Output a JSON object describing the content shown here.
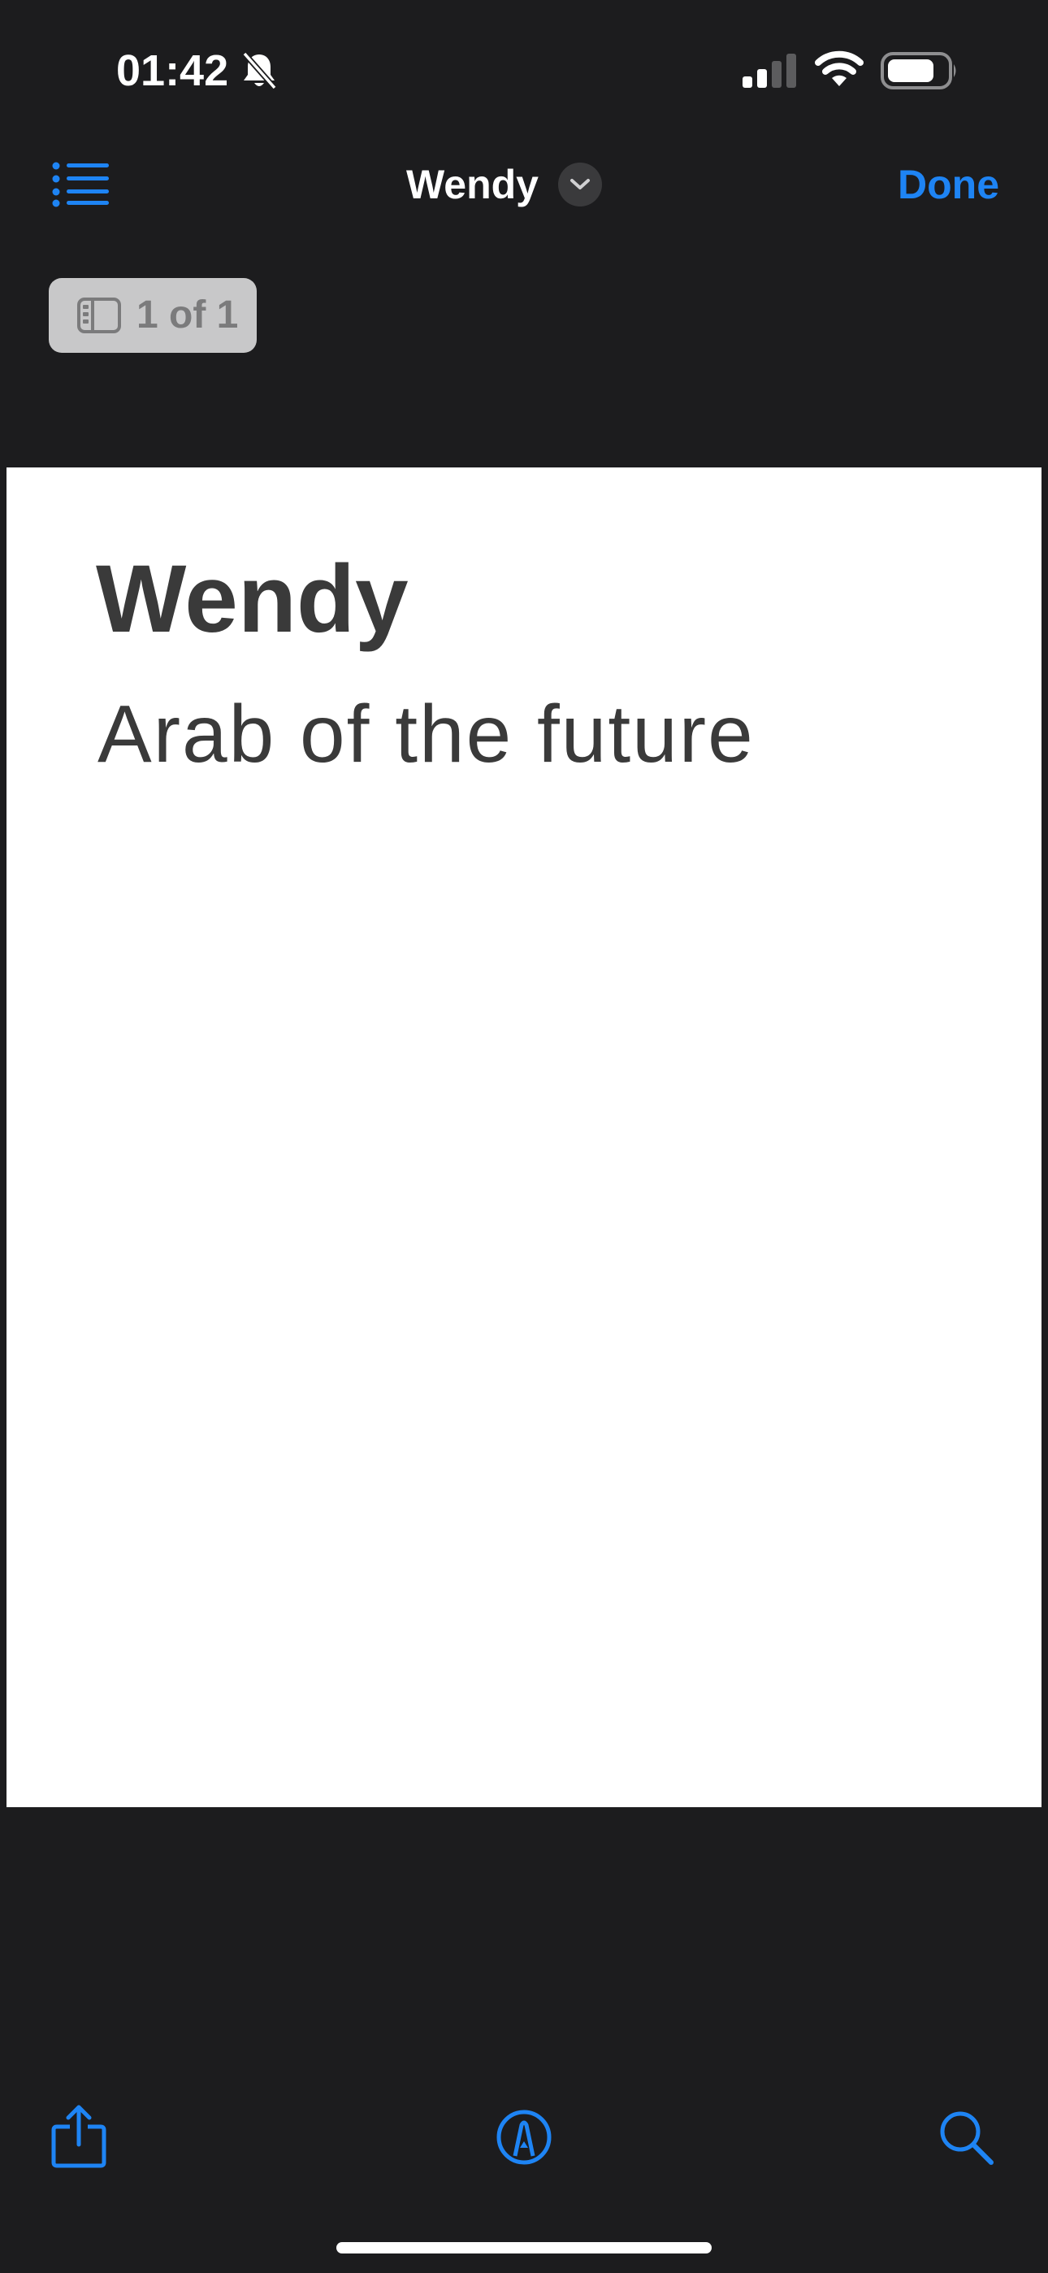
{
  "status_bar": {
    "time": "01:42",
    "icons": [
      "bell-slash-icon",
      "cellular-signal-icon",
      "wifi-icon",
      "battery-icon"
    ]
  },
  "nav_bar": {
    "title": "Wendy",
    "done_label": "Done",
    "icons": [
      "list-icon",
      "chevron-down-icon"
    ]
  },
  "page_indicator": {
    "label": "1 of 1",
    "icon": "sidebar-icon"
  },
  "document": {
    "heading": "Wendy",
    "subtitle": "Arab of the future"
  },
  "toolbar": {
    "icons": [
      "share-icon",
      "markup-icon",
      "search-icon"
    ]
  },
  "colors": {
    "background": "#1c1c1e",
    "accent": "#1e84f4",
    "page": "#ffffff",
    "page_text": "#3a3a3a",
    "pill": "#c8c8c9"
  }
}
